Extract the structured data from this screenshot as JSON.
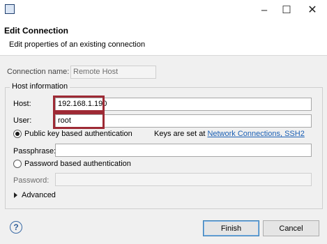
{
  "titlebar": {
    "app_icon_text": "",
    "min_glyph": "–",
    "max_glyph": "☐",
    "close_glyph": "✕"
  },
  "banner": {
    "title": "Edit Connection",
    "description": "Edit properties of an existing connection"
  },
  "connection": {
    "label": "Connection name:",
    "value": "Remote Host"
  },
  "host_group": {
    "title": "Host information",
    "host_label": "Host:",
    "host_value": "192.168.1.190",
    "user_label": "User:",
    "user_value": "root",
    "pubkey_label": "Public key based authentication",
    "keys_prefix": "Keys are set at ",
    "keys_link": "Network Connections, SSH2",
    "passphrase_label": "Passphrase:",
    "passphrase_value": "",
    "password_auth_label": "Password based authentication",
    "password_label": "Password:",
    "password_value": ""
  },
  "advanced": {
    "label": "Advanced"
  },
  "footer": {
    "help_glyph": "?",
    "finish_label": "Finish",
    "cancel_label": "Cancel"
  },
  "colors": {
    "highlight": "#9e2a35",
    "link": "#1a5fb4"
  }
}
